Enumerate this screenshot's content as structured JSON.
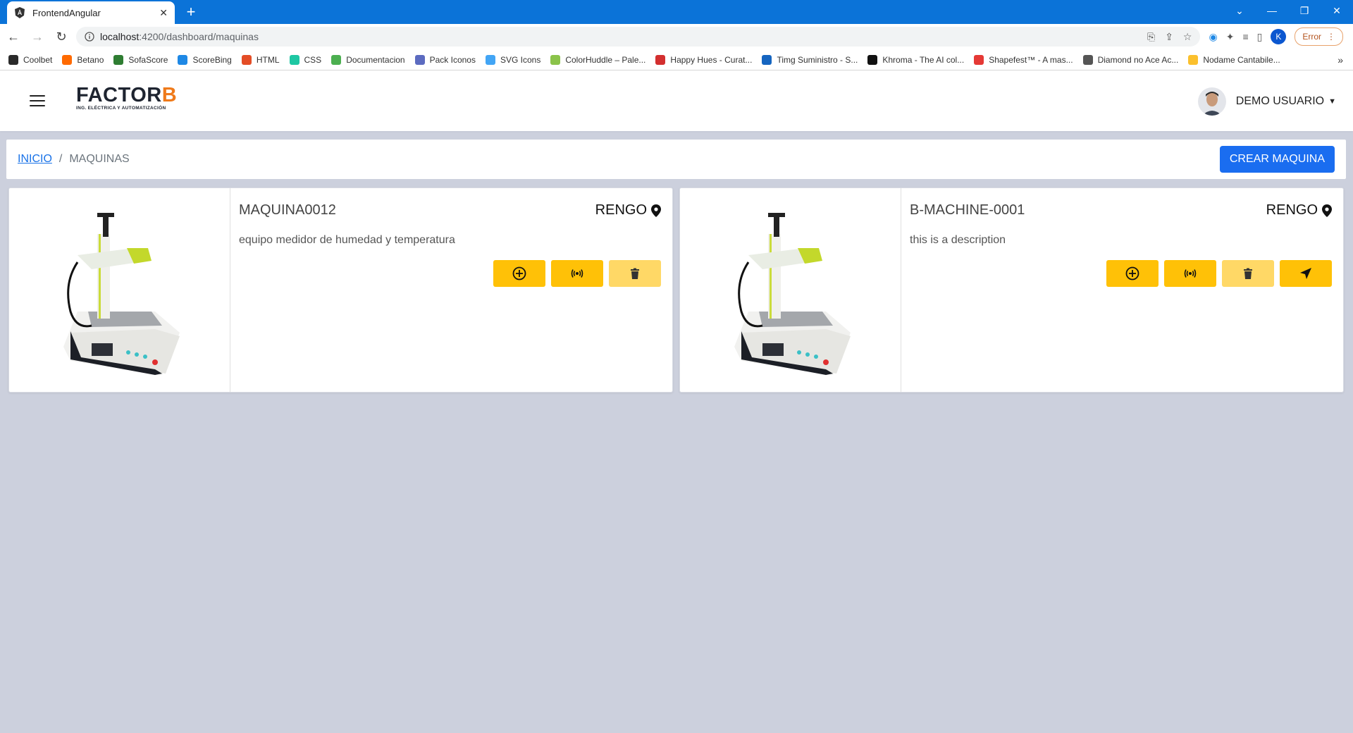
{
  "browser": {
    "tab_title": "FrontendAngular",
    "new_tab": "+",
    "url_host": "localhost",
    "url_path": ":4200/dashboard/maquinas",
    "profile_initial": "K",
    "error_label": "Error",
    "bookmarks": [
      {
        "label": "Coolbet",
        "color": "#2a2a2a"
      },
      {
        "label": "Betano",
        "color": "#ff6a00"
      },
      {
        "label": "SofaScore",
        "color": "#2e7d32"
      },
      {
        "label": "ScoreBing",
        "color": "#1e88e5"
      },
      {
        "label": "HTML",
        "color": "#e44d26"
      },
      {
        "label": "CSS",
        "color": "#1ec7a3"
      },
      {
        "label": "Documentacion",
        "color": "#4caf50"
      },
      {
        "label": "Pack Iconos",
        "color": "#5c6bc0"
      },
      {
        "label": "SVG Icons",
        "color": "#42a5f5"
      },
      {
        "label": "ColorHuddle – Pale...",
        "color": "#8bc34a"
      },
      {
        "label": "Happy Hues - Curat...",
        "color": "#d32f2f"
      },
      {
        "label": "Timg Suministro - S...",
        "color": "#1565c0"
      },
      {
        "label": "Khroma - The AI col...",
        "color": "#111111"
      },
      {
        "label": "Shapefest™ - A mas...",
        "color": "#e53935"
      },
      {
        "label": "Diamond no Ace Ac...",
        "color": "#555555"
      },
      {
        "label": "Nodame Cantabile...",
        "color": "#fbc02d"
      }
    ],
    "bookmarks_more": "»"
  },
  "header": {
    "logo_main": "FACTOR",
    "logo_b": "B",
    "logo_sub": "ING. ELÉCTRICA Y AUTOMATIZACIÓN",
    "user_name": "DEMO USUARIO"
  },
  "breadcrumb": {
    "home": "INICIO",
    "separator": "/",
    "current": "MAQUINAS",
    "create_button": "CREAR MAQUINA"
  },
  "cards": [
    {
      "title": "MAQUINA0012",
      "location": "RENGO",
      "description": "equipo medidor de humedad y temperatura"
    },
    {
      "title": "B-MACHINE-0001",
      "location": "RENGO",
      "description": "this is a description"
    }
  ],
  "colors": {
    "accent_yellow": "#ffc107",
    "primary_blue": "#1a6df0",
    "page_bg": "#ccd0dd",
    "logo_orange": "#ef7a1a"
  }
}
